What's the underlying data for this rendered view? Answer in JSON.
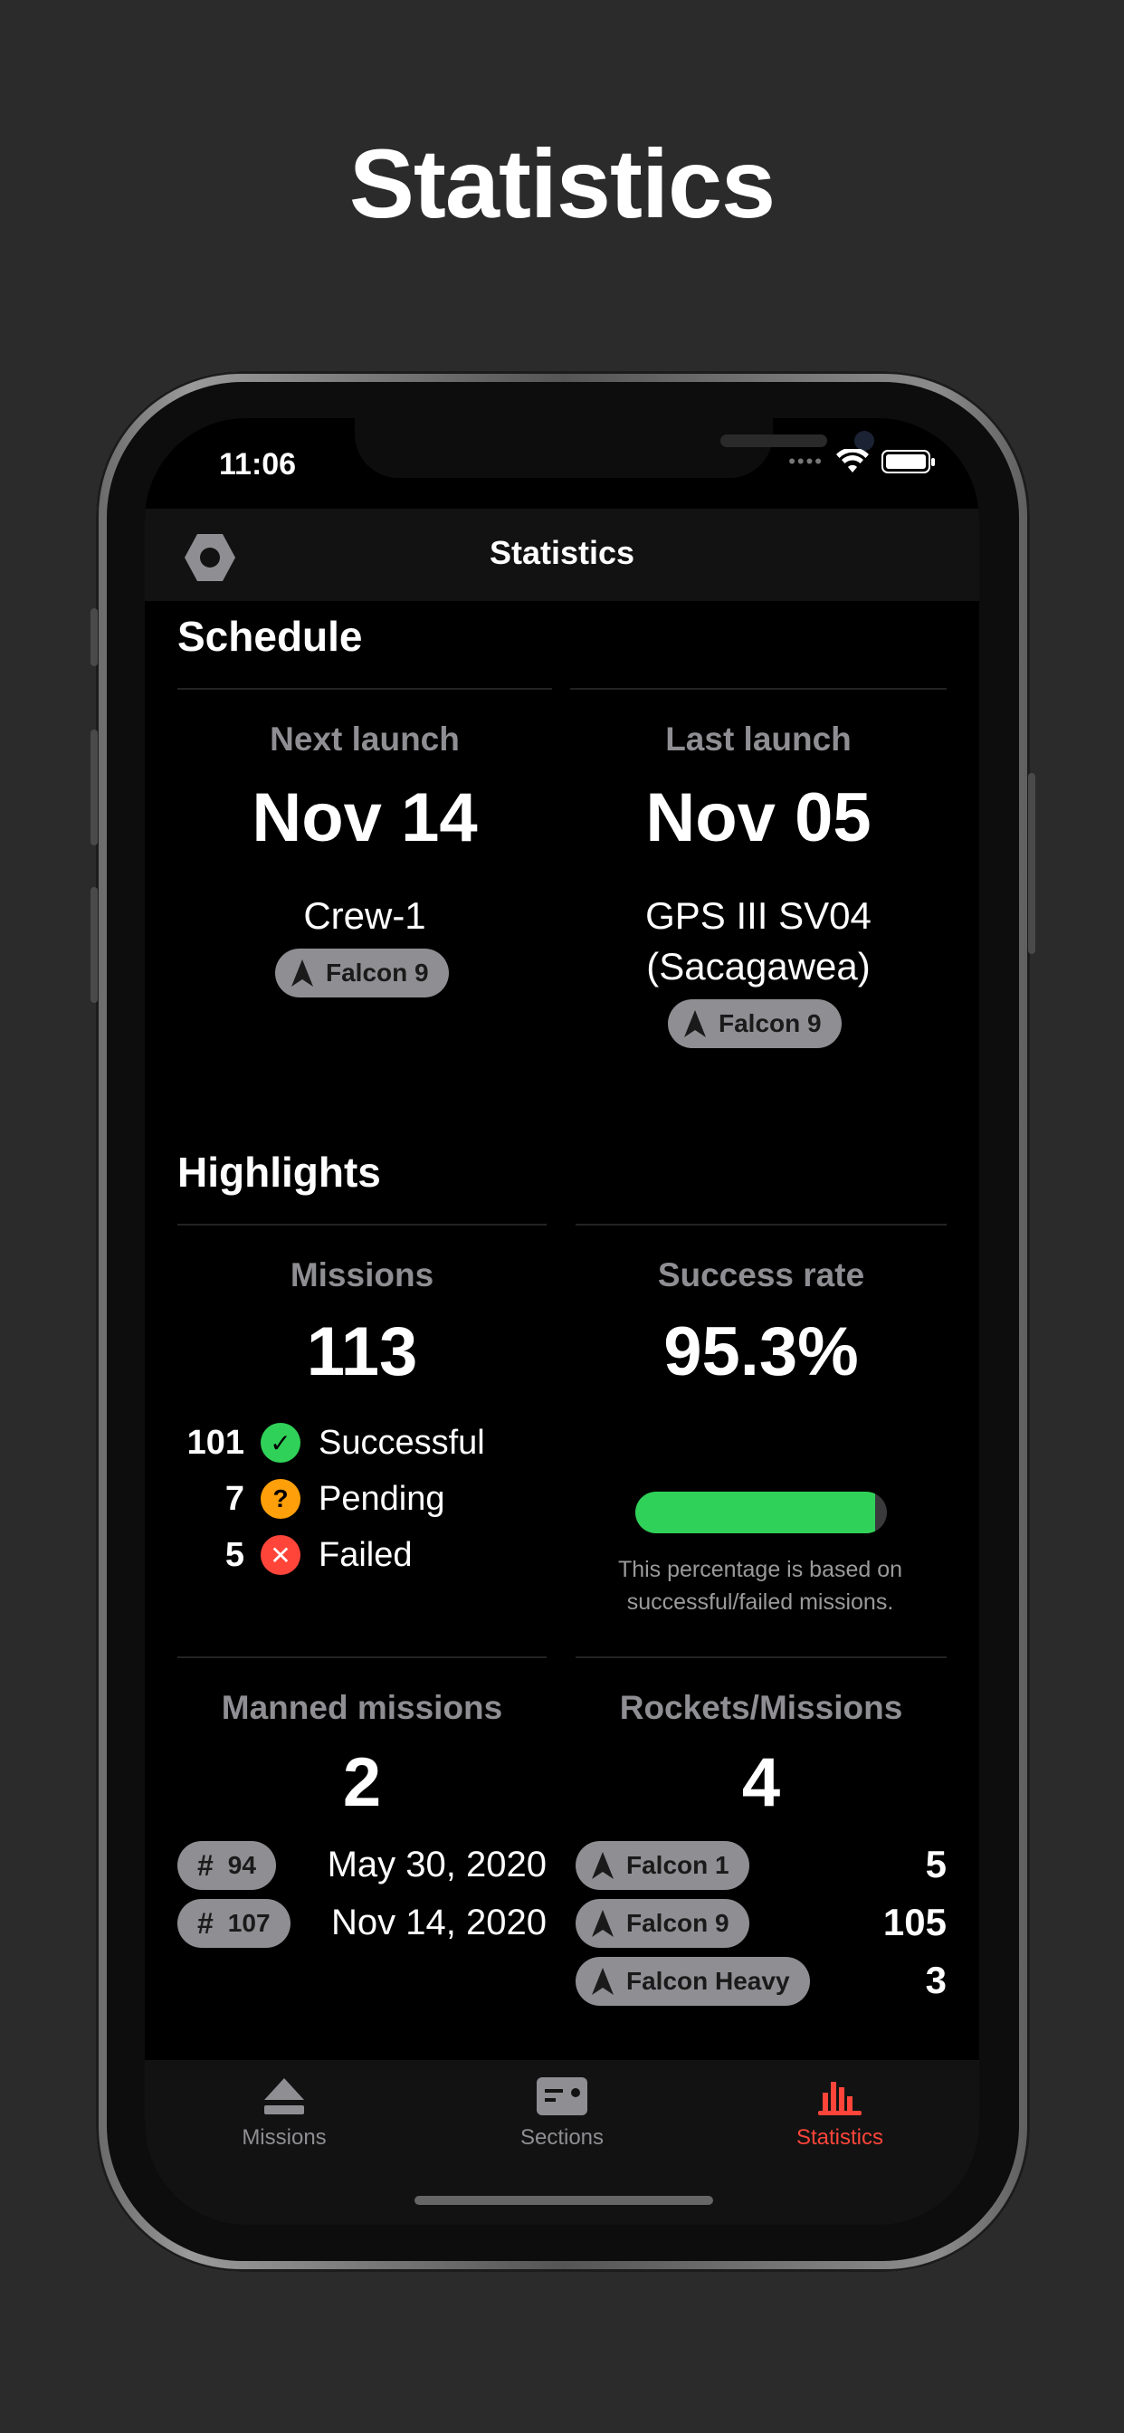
{
  "promo": {
    "title": "Statistics"
  },
  "status_bar": {
    "time": "11:06"
  },
  "navbar": {
    "title": "Statistics",
    "settings_icon": "hexagon-settings-icon"
  },
  "schedule": {
    "title": "Schedule",
    "next": {
      "label": "Next launch",
      "date": "Nov 14",
      "mission_line1": "Crew-1",
      "mission_line2": "",
      "rocket": "Falcon 9"
    },
    "last": {
      "label": "Last launch",
      "date": "Nov 05",
      "mission_line1": "GPS III SV04",
      "mission_line2": "(Sacagawea)",
      "rocket": "Falcon 9"
    }
  },
  "highlights": {
    "title": "Highlights",
    "missions": {
      "label": "Missions",
      "value": "113",
      "rows": [
        {
          "count": "101",
          "label": "Successful",
          "icon": "checkmark-icon",
          "color": "#30d158",
          "glyph": "✓"
        },
        {
          "count": "7",
          "label": "Pending",
          "icon": "question-icon",
          "color": "#ff9f0a",
          "glyph": "?"
        },
        {
          "count": "5",
          "label": "Failed",
          "icon": "xmark-icon",
          "color": "#ff453a",
          "glyph": "✕"
        }
      ]
    },
    "success_rate": {
      "label": "Success rate",
      "value": "95.3%",
      "progress": 0.953,
      "note_line1": "This percentage is based on",
      "note_line2": "successful/failed missions."
    },
    "manned": {
      "label": "Manned missions",
      "value": "2",
      "items": [
        {
          "number": "94",
          "date": "May 30, 2020"
        },
        {
          "number": "107",
          "date": "Nov 14, 2020"
        }
      ]
    },
    "rockets": {
      "label": "Rockets/Missions",
      "value": "4",
      "items": [
        {
          "name": "Falcon 1",
          "count": "5"
        },
        {
          "name": "Falcon 9",
          "count": "105"
        },
        {
          "name": "Falcon Heavy",
          "count": "3"
        }
      ]
    }
  },
  "tabbar": {
    "tabs": [
      {
        "label": "Missions",
        "icon": "eject-icon",
        "active": false
      },
      {
        "label": "Sections",
        "icon": "card-icon",
        "active": false
      },
      {
        "label": "Statistics",
        "icon": "chart-bars-icon",
        "active": true
      }
    ],
    "active_color": "#ff453a",
    "inactive_color": "#8e8e93"
  }
}
